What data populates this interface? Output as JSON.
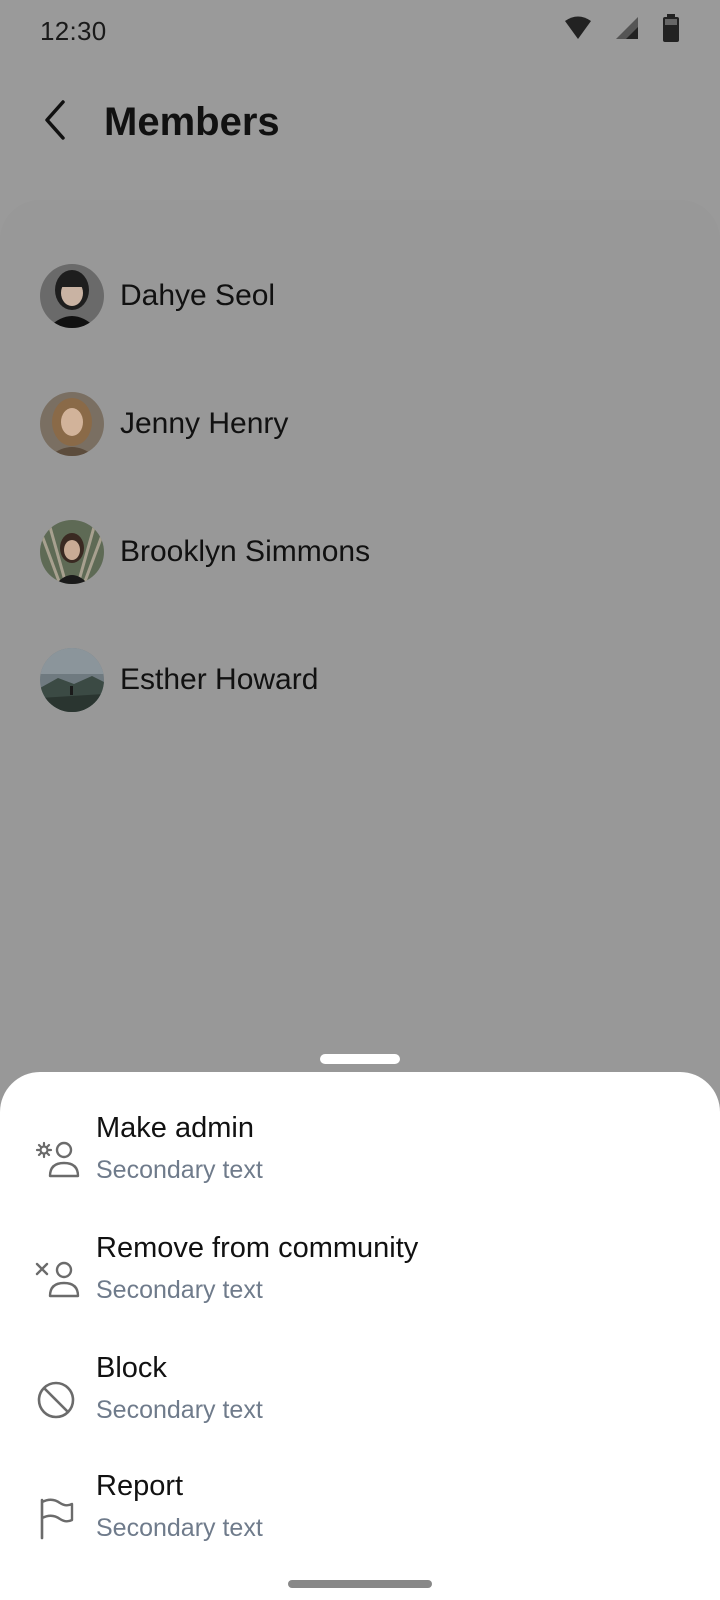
{
  "status_bar": {
    "time": "12:30",
    "icons": [
      "wifi-icon",
      "cellular-signal-icon",
      "battery-icon"
    ]
  },
  "header": {
    "title": "Members",
    "back_icon": "chevron-left-icon"
  },
  "members": [
    {
      "name": "Dahye Seol",
      "avatar": "person-photo"
    },
    {
      "name": "Jenny Henry",
      "avatar": "person-photo"
    },
    {
      "name": "Brooklyn Simmons",
      "avatar": "person-photo"
    },
    {
      "name": "Esther Howard",
      "avatar": "landscape-photo"
    }
  ],
  "action_sheet": {
    "items": [
      {
        "label": "Make admin",
        "secondary": "Secondary text",
        "icon": "user-settings-icon"
      },
      {
        "label": "Remove from community",
        "secondary": "Secondary text",
        "icon": "user-remove-icon"
      },
      {
        "label": "Block",
        "secondary": "Secondary text",
        "icon": "block-icon"
      },
      {
        "label": "Report",
        "secondary": "Secondary text",
        "icon": "flag-icon"
      }
    ]
  },
  "colors": {
    "scrim": "#9a9a9a",
    "sheet_background": "#ffffff",
    "secondary_text": "#6f7b8b",
    "icon": "#6b6b6b"
  }
}
